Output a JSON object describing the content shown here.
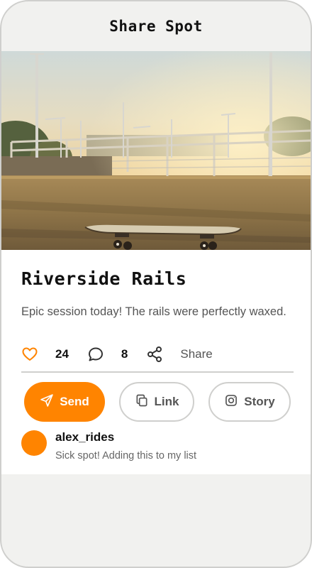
{
  "screen": {
    "title": "Share Spot"
  },
  "spot": {
    "name": "Riverside Rails",
    "description": "Epic session today! The rails were perfectly waxed."
  },
  "stats": {
    "likes": "24",
    "comments": "8",
    "share_label": "Share",
    "like_icon": "heart-icon",
    "comment_icon": "comment-bubble-icon",
    "share_icon": "share-nodes-icon"
  },
  "actions": {
    "send_label": "Send",
    "link_label": "Link",
    "story_label": "Story",
    "send_icon": "paper-plane-icon",
    "link_icon": "copy-icon",
    "story_icon": "instagram-icon"
  },
  "comment": {
    "user": "alex_rides",
    "text": "Sick spot! Adding this to my list"
  },
  "colors": {
    "accent": "#ff8400",
    "background": "#f1f1ef",
    "border": "#cfcfcd",
    "text_primary": "#111111",
    "text_secondary": "#555555"
  }
}
